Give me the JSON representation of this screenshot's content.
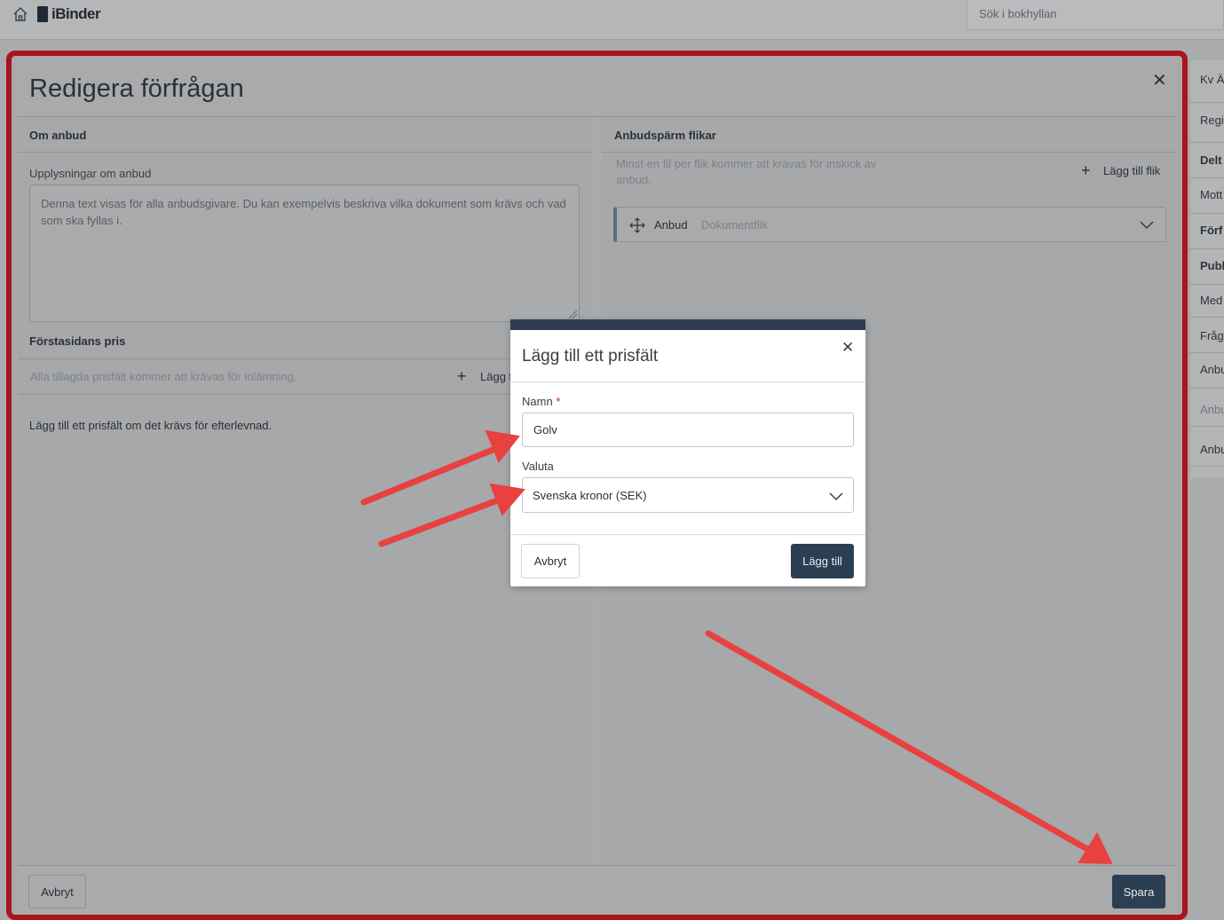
{
  "topbar": {
    "logo_text": "iBinder",
    "search_placeholder": "Sök i bokhyllan"
  },
  "side_items": [
    {
      "label": "Kv Ä",
      "bold": false,
      "dim": false
    },
    {
      "label": "Regis",
      "bold": false,
      "dim": false
    },
    {
      "label": "Delt",
      "bold": true,
      "dim": false
    },
    {
      "label": "Mott",
      "bold": false,
      "dim": false
    },
    {
      "label": "Förf",
      "bold": true,
      "dim": false
    },
    {
      "label": "Publ",
      "bold": true,
      "dim": false
    },
    {
      "label": "Med",
      "bold": false,
      "dim": false
    },
    {
      "label": "Fråg",
      "bold": false,
      "dim": false
    },
    {
      "label": "Anbu",
      "bold": false,
      "dim": false
    },
    {
      "label": "Anbu",
      "bold": false,
      "dim": true
    },
    {
      "label": "Anbu",
      "bold": false,
      "dim": false
    }
  ],
  "modal": {
    "title": "Redigera förfrågan",
    "left": {
      "section1": "Om anbud",
      "info_label": "Upplysningar om anbud",
      "info_placeholder": "Denna text visas för alla anbudsgivare. Du kan exempelvis beskriva vilka dokument som krävs och vad som ska fyllas i.",
      "section2": "Förstasidans pris",
      "price_hint": "Alla tillagda prisfält kommer att krävas för inlämning.",
      "add_price_label": "Lägg t",
      "price_body": "Lägg till ett prisfält om det krävs för efterlevnad."
    },
    "right": {
      "section": "Anbudspärm flikar",
      "hint": "Minst en fil per flik kommer att krävas för inskick av anbud.",
      "add_tab_label": "Lägg till flik",
      "tab_name": "Anbud",
      "tab_type": "Dokumentflik"
    },
    "footer": {
      "cancel": "Avbryt",
      "save": "Spara"
    }
  },
  "dialog": {
    "title": "Lägg till ett prisfält",
    "name_label": "Namn",
    "required_mark": "*",
    "name_value": "Golv",
    "currency_label": "Valuta",
    "currency_value": "Svenska kronor (SEK)",
    "cancel": "Avbryt",
    "add": "Lägg till"
  },
  "colors": {
    "frame_red": "#a8151b",
    "primary": "#2c3e52",
    "arrow_red": "#e8413f"
  }
}
